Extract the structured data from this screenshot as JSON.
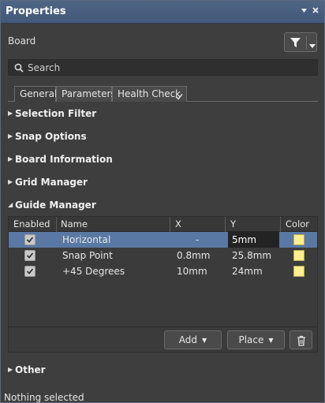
{
  "window": {
    "title": "Properties",
    "pin_icon": "pin-down-icon",
    "close_icon": "close-icon"
  },
  "header": {
    "object_label": "Board",
    "filter_icon": "funnel-icon"
  },
  "search": {
    "placeholder": "Search"
  },
  "tabs": [
    {
      "label": "General",
      "active": true
    },
    {
      "label": "Parameters",
      "active": false
    },
    {
      "label": "Health Check",
      "active": false
    }
  ],
  "sections": {
    "selection_filter": {
      "label": "Selection Filter",
      "expanded": false
    },
    "snap_options": {
      "label": "Snap Options",
      "expanded": false
    },
    "board_information": {
      "label": "Board Information",
      "expanded": false
    },
    "grid_manager": {
      "label": "Grid Manager",
      "expanded": false
    },
    "guide_manager": {
      "label": "Guide Manager",
      "expanded": true
    },
    "other": {
      "label": "Other",
      "expanded": false
    }
  },
  "guide_table": {
    "columns": [
      "Enabled",
      "Name",
      "X",
      "Y",
      "Color"
    ],
    "rows": [
      {
        "enabled": true,
        "name": "Horizontal",
        "x": "-",
        "y": "5mm",
        "color": "#fdee8e",
        "selected": true
      },
      {
        "enabled": true,
        "name": "Snap Point",
        "x": "0.8mm",
        "y": "25.8mm",
        "color": "#fdee8e",
        "selected": false
      },
      {
        "enabled": true,
        "name": "+45 Degrees",
        "x": "10mm",
        "y": "24mm",
        "color": "#fdee8e",
        "selected": false
      }
    ],
    "buttons": {
      "add": "Add",
      "place": "Place"
    }
  },
  "status": "Nothing selected",
  "colors": {
    "title_bar": "#4f6584",
    "selection": "#5978a3",
    "background": "#3e3e3e"
  }
}
